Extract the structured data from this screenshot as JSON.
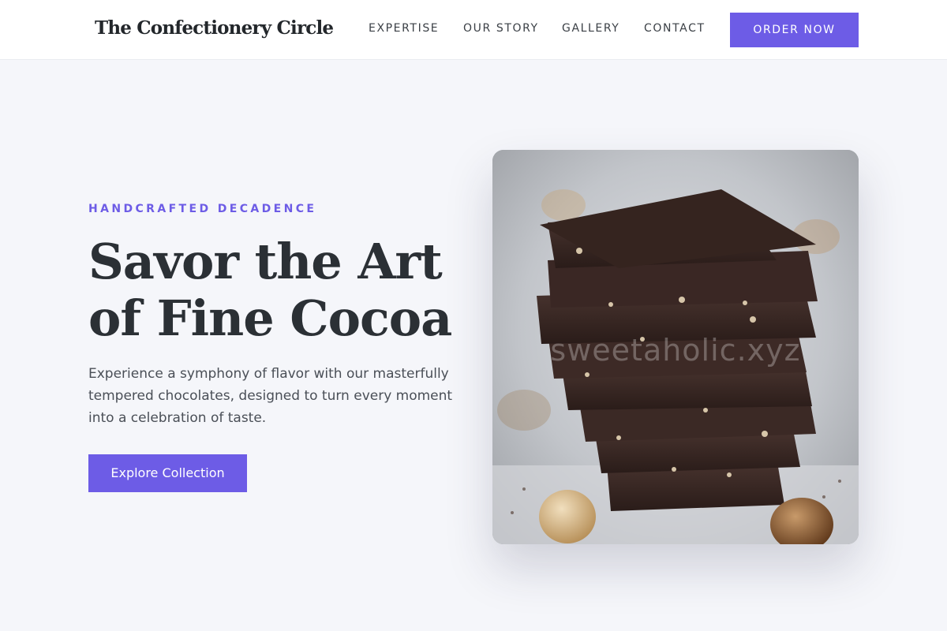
{
  "header": {
    "brand": "The Confectionery Circle",
    "nav": [
      "EXPERTISE",
      "OUR STORY",
      "GALLERY",
      "CONTACT"
    ],
    "cta_label": "ORDER NOW"
  },
  "hero": {
    "eyebrow": "HANDCRAFTED DECADENCE",
    "headline_line1": "Savor the Art",
    "headline_line2": "of Fine Cocoa",
    "lead": "Experience a symphony of flavor with our masterfully tempered chocolates, designed to turn every moment into a celebration of taste.",
    "cta_label": "Explore Collection",
    "image_watermark": "sweetaholic.xyz"
  },
  "colors": {
    "accent": "#6d5ce6",
    "background": "#f5f6fa",
    "text": "#2b3035"
  },
  "icons": {
    "hero_image": "chocolate-stack-photo"
  }
}
